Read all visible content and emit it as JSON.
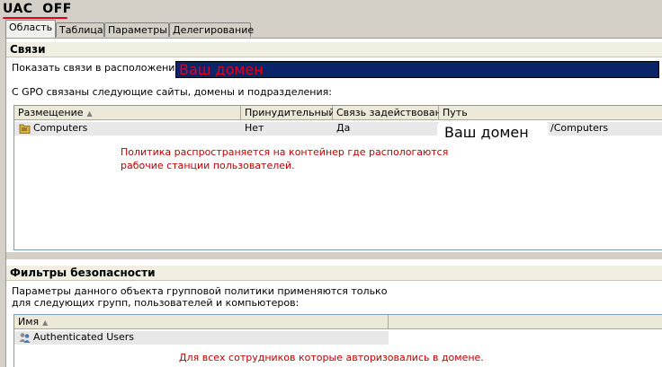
{
  "header": {
    "title": "UAC  OFF"
  },
  "tabs": [
    {
      "label": "Область",
      "active": true
    },
    {
      "label": "Таблица",
      "active": false
    },
    {
      "label": "Параметры",
      "active": false
    },
    {
      "label": "Делегирование",
      "active": false
    }
  ],
  "links_section": {
    "title": "Связи",
    "location_label": "Показать связи в расположении:",
    "location_value": "Ваш домен",
    "description": "С GPO связаны следующие сайты, домены и подразделения:",
    "columns": [
      "Размещение",
      "Принудительный",
      "Связь задействована",
      "Путь"
    ],
    "rows": [
      {
        "name": "Computers",
        "enforced": "Нет",
        "enabled": "Да",
        "path_masked": "Ваш домен",
        "path_suffix": "/Computers"
      }
    ],
    "note_lines": [
      "Политика распространяется на контейнер где распологаются",
      "рабочие станции пользователей."
    ]
  },
  "security_section": {
    "title": "Фильтры безопасности",
    "description_lines": [
      "Параметры данного объекта групповой политики применяются только",
      "для следующих групп, пользователей и компьютеров:"
    ],
    "columns": [
      "Имя"
    ],
    "rows": [
      {
        "name": "Authenticated Users"
      }
    ],
    "note": "Для всех сотрудников которые авторизовались в домене."
  },
  "colors": {
    "annotation": "#e0001b",
    "selection": "#0a246a"
  },
  "icons": [
    "ou-folder-icon",
    "users-group-icon",
    "sort-ascending-icon"
  ]
}
